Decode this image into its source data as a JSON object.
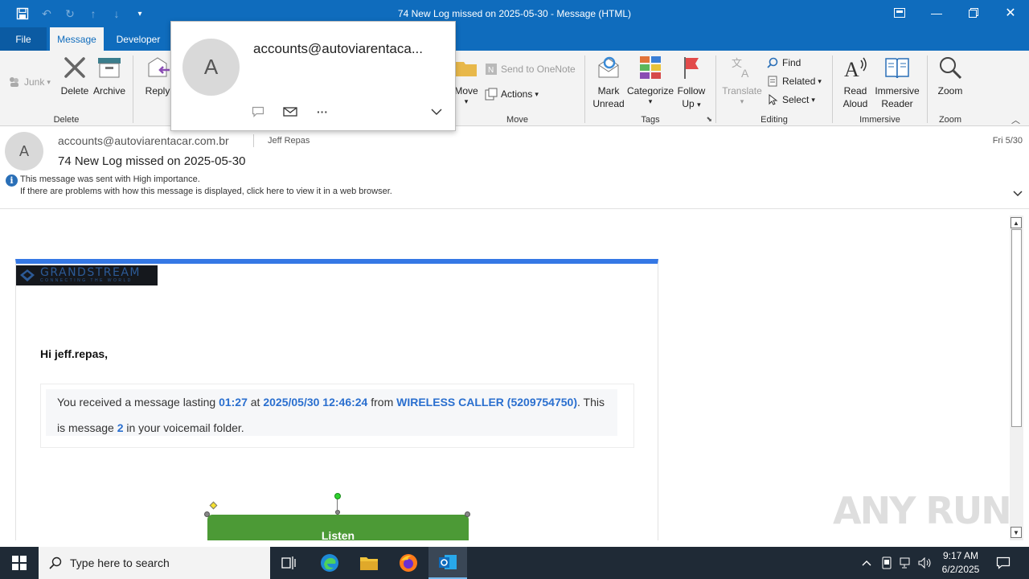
{
  "window": {
    "title": "74 New Log missed on 2025-05-30  -  Message (HTML)"
  },
  "tabs": [
    {
      "label": "File"
    },
    {
      "label": "Message"
    },
    {
      "label": "Developer"
    }
  ],
  "ribbon": {
    "delete_group": {
      "label": "Delete",
      "junk": "Junk",
      "delete": "Delete",
      "archive": "Archive"
    },
    "respond": {
      "reply": "Reply"
    },
    "move_group": {
      "label": "Move",
      "move": "Move",
      "send_onenote": "Send to OneNote",
      "actions": "Actions"
    },
    "tags_group": {
      "label": "Tags",
      "mark_unread_1": "Mark",
      "mark_unread_2": "Unread",
      "categorize": "Categorize",
      "follow_up_1": "Follow",
      "follow_up_2": "Up"
    },
    "editing_group": {
      "label": "Editing",
      "translate": "Translate",
      "find": "Find",
      "related": "Related",
      "select": "Select"
    },
    "immersive_group": {
      "label": "Immersive",
      "read_aloud_1": "Read",
      "read_aloud_2": "Aloud",
      "immersive_reader_1": "Immersive",
      "immersive_reader_2": "Reader"
    },
    "zoom_group": {
      "label": "Zoom",
      "zoom": "Zoom"
    }
  },
  "contact_card": {
    "initial": "A",
    "email": "accounts@autoviarentaca..."
  },
  "message": {
    "initial": "A",
    "from": "accounts@autoviarentacar.com.br",
    "to": "Jeff Repas",
    "date": "Fri 5/30",
    "subject": "74 New Log missed on 2025-05-30",
    "importance": "This message was sent with High importance.",
    "display_note": "If there are problems with how this message is displayed, click here to view it in a web browser."
  },
  "body": {
    "logo_text": "GRANDSTREAM",
    "logo_tagline": "CONNECTING THE WORLD",
    "greeting": "Hi jeff.repas,",
    "line1_a": "You received a message lasting ",
    "duration": "01:27",
    "line1_b": " at ",
    "timestamp": "2025/05/30 12:46:24",
    "line1_c": " from ",
    "caller": "WIRELESS CALLER (5209754750)",
    "line1_d": ". This",
    "line2_a": "is message ",
    "msg_number": "2",
    "line2_b": " in your voicemail folder.",
    "listen": "Listen"
  },
  "watermark": "ANY RUN",
  "taskbar": {
    "search_placeholder": "Type here to search",
    "time": "9:17 AM",
    "date": "6/2/2025"
  },
  "colors": {
    "accent": "#0f6cbd",
    "highlight": "#2a6fcf",
    "listen_button": "#4c9a36",
    "email_banner": "#3578e5"
  }
}
